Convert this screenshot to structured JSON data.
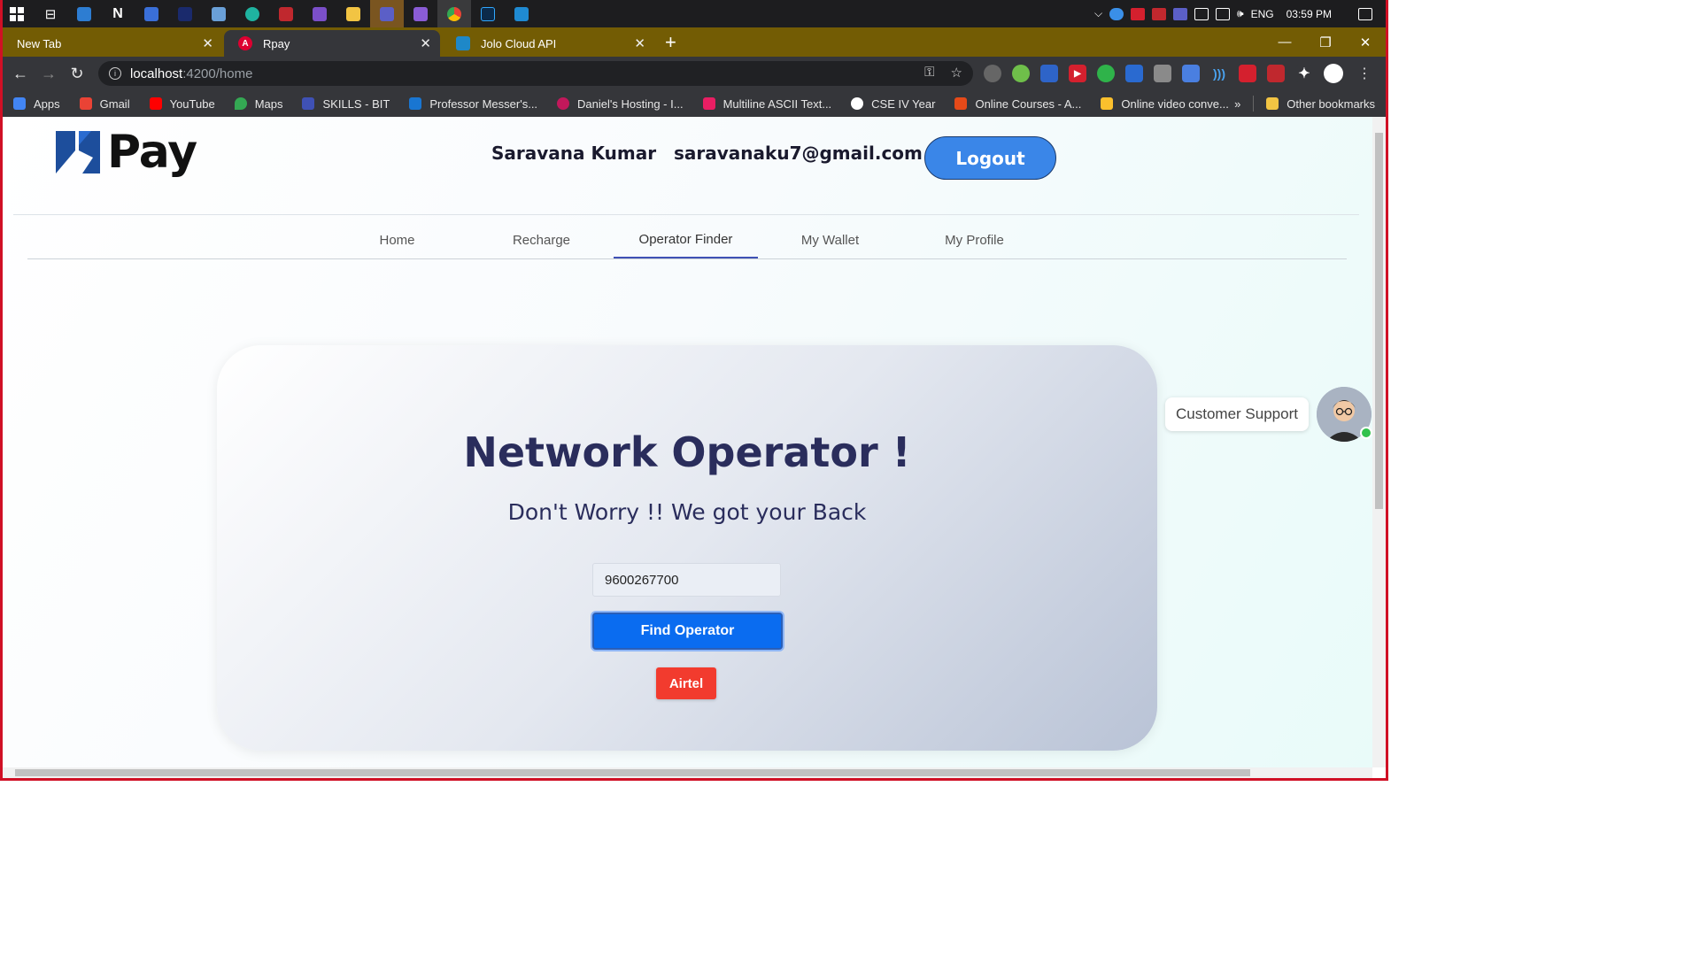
{
  "taskbar": {
    "tray": {
      "language": "ENG",
      "time": "03:59 PM"
    }
  },
  "browser": {
    "tabs": [
      {
        "label": "New Tab"
      },
      {
        "label": "Rpay"
      },
      {
        "label": "Jolo Cloud API"
      }
    ],
    "url_host": "localhost",
    "url_path": ":4200/home",
    "bookmarks": [
      {
        "label": "Apps",
        "color": "#4285f4"
      },
      {
        "label": "Gmail",
        "color": "#ea4335"
      },
      {
        "label": "YouTube",
        "color": "#ff0000"
      },
      {
        "label": "Maps",
        "color": "#34a853"
      },
      {
        "label": "SKILLS - BIT",
        "color": "#3f51b5"
      },
      {
        "label": "Professor Messer's...",
        "color": "#1976d2"
      },
      {
        "label": "Daniel's Hosting - I...",
        "color": "#c2185b"
      },
      {
        "label": "Multiline ASCII Text...",
        "color": "#e91e63"
      },
      {
        "label": "CSE IV Year",
        "color": "#ffffff"
      },
      {
        "label": "Online Courses - A...",
        "color": "#e64a19"
      },
      {
        "label": "Online video conve...",
        "color": "#fbc02d"
      }
    ],
    "bookmarks_more": "»",
    "other_bookmarks": "Other bookmarks"
  },
  "app": {
    "logo_text": "Pay",
    "user_name": "Saravana Kumar",
    "user_email": "saravanaku7@gmail.com",
    "logout_label": "Logout",
    "menu": [
      {
        "label": "Home"
      },
      {
        "label": "Recharge"
      },
      {
        "label": "Operator Finder"
      },
      {
        "label": "My Wallet"
      },
      {
        "label": "My Profile"
      }
    ],
    "card": {
      "title": "Network Operator !",
      "subtitle": "Don't Worry !! We got your Back",
      "phone_value": "9600267700",
      "find_label": "Find Operator",
      "result": "Airtel"
    },
    "support_label": "Customer Support"
  }
}
